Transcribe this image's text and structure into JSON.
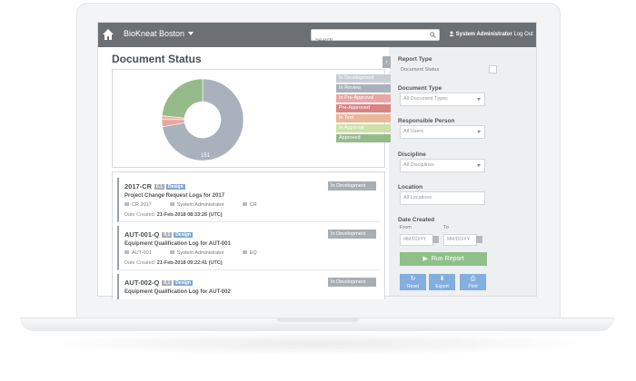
{
  "app": {
    "brand": "BioKneat Boston",
    "search_placeholder": "Search ...",
    "user_name": "System Administrator",
    "logout": "Log Out"
  },
  "page": {
    "title": "Document Status"
  },
  "chart_data": {
    "type": "pie",
    "labels": [
      "In Development",
      "In Review",
      "In Pre-Approval",
      "Pre-Approved",
      "In Test",
      "In Approval",
      "Approved"
    ],
    "values": [
      0,
      151,
      6,
      0,
      3,
      0,
      49
    ],
    "slice_labels": [
      "151",
      "49",
      "5"
    ],
    "colors": {
      "In Development": "#c9ced3",
      "In Review": "#a9b2bc",
      "In Pre-Approval": "#e7a6a6",
      "Pre-Approved": "#d98383",
      "In Test": "#e9b79a",
      "In Approval": "#cde0a6",
      "Approved": "#96bb8b"
    }
  },
  "legend": [
    {
      "label": "In Development",
      "color": "#c9ced3"
    },
    {
      "label": "In Review",
      "color": "#a9b2bc"
    },
    {
      "label": "In Pre-Approval",
      "color": "#e7a6a6"
    },
    {
      "label": "Pre-Approved",
      "color": "#d98383"
    },
    {
      "label": "In Test",
      "color": "#e9b79a"
    },
    {
      "label": "In Approval",
      "color": "#cde0a6"
    },
    {
      "label": "Approved",
      "color": "#96bb8b"
    }
  ],
  "documents": [
    {
      "id": "2017-CR",
      "version": "0.1",
      "type": "Design",
      "title": "Project Change Request Logs for 2017",
      "ref": "CR 2017",
      "owner": "System Administrator",
      "category": "CR",
      "created_label": "Date Created:",
      "created": "21-Feb-2018 08:33:26 (UTC)",
      "status": "In Development"
    },
    {
      "id": "AUT-001-Q",
      "version": "0.1",
      "type": "Design",
      "title": "Equipment Qualification Log for AUT-001",
      "ref": "AUT-001",
      "owner": "System Administrator",
      "category": "EQ",
      "created_label": "Date Created:",
      "created": "21-Feb-2018 09:22:41 (UTC)",
      "status": "In Development"
    },
    {
      "id": "AUT-002-Q",
      "version": "0.1",
      "type": "Design",
      "title": "Equipment Qualification Log for AUT-002",
      "ref": "",
      "owner": "",
      "category": "",
      "created_label": "",
      "created": "",
      "status": "In Development"
    }
  ],
  "filters": {
    "report_type_label": "Report Type",
    "report_type_value": "Document Status",
    "doc_type_label": "Document Type",
    "doc_type_value": "All Document Types",
    "person_label": "Responsible Person",
    "person_value": "All Users",
    "discipline_label": "Discipline",
    "discipline_value": "All Disciplines",
    "location_label": "Location",
    "location_value": "All Locations",
    "date_label": "Date Created",
    "from_label": "From",
    "to_label": "To",
    "from_placeholder": "MM/DD/YY",
    "to_placeholder": "MM/DD/YY",
    "run_label": "Run Report",
    "reset_label": "Reset",
    "export_label": "Export",
    "print_label": "Print"
  }
}
